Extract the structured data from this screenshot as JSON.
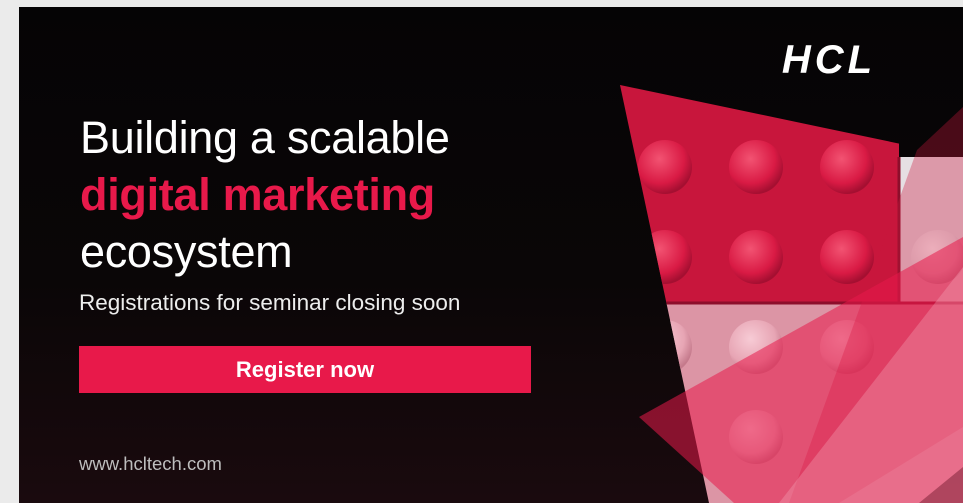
{
  "ad": {
    "brand": "HCL",
    "headline_line1": "Building a scalable",
    "headline_accent": "digital marketing",
    "headline_line3": "ecosystem",
    "subtitle": "Registrations for seminar closing soon",
    "cta_label": "Register now",
    "url": "www.hcltech.com"
  },
  "colors": {
    "accent": "#e8194a",
    "background": "#050405",
    "text": "#ffffff"
  },
  "icons": {
    "logo": "hcl-logo",
    "artwork": "lego-bricks-triangles"
  }
}
